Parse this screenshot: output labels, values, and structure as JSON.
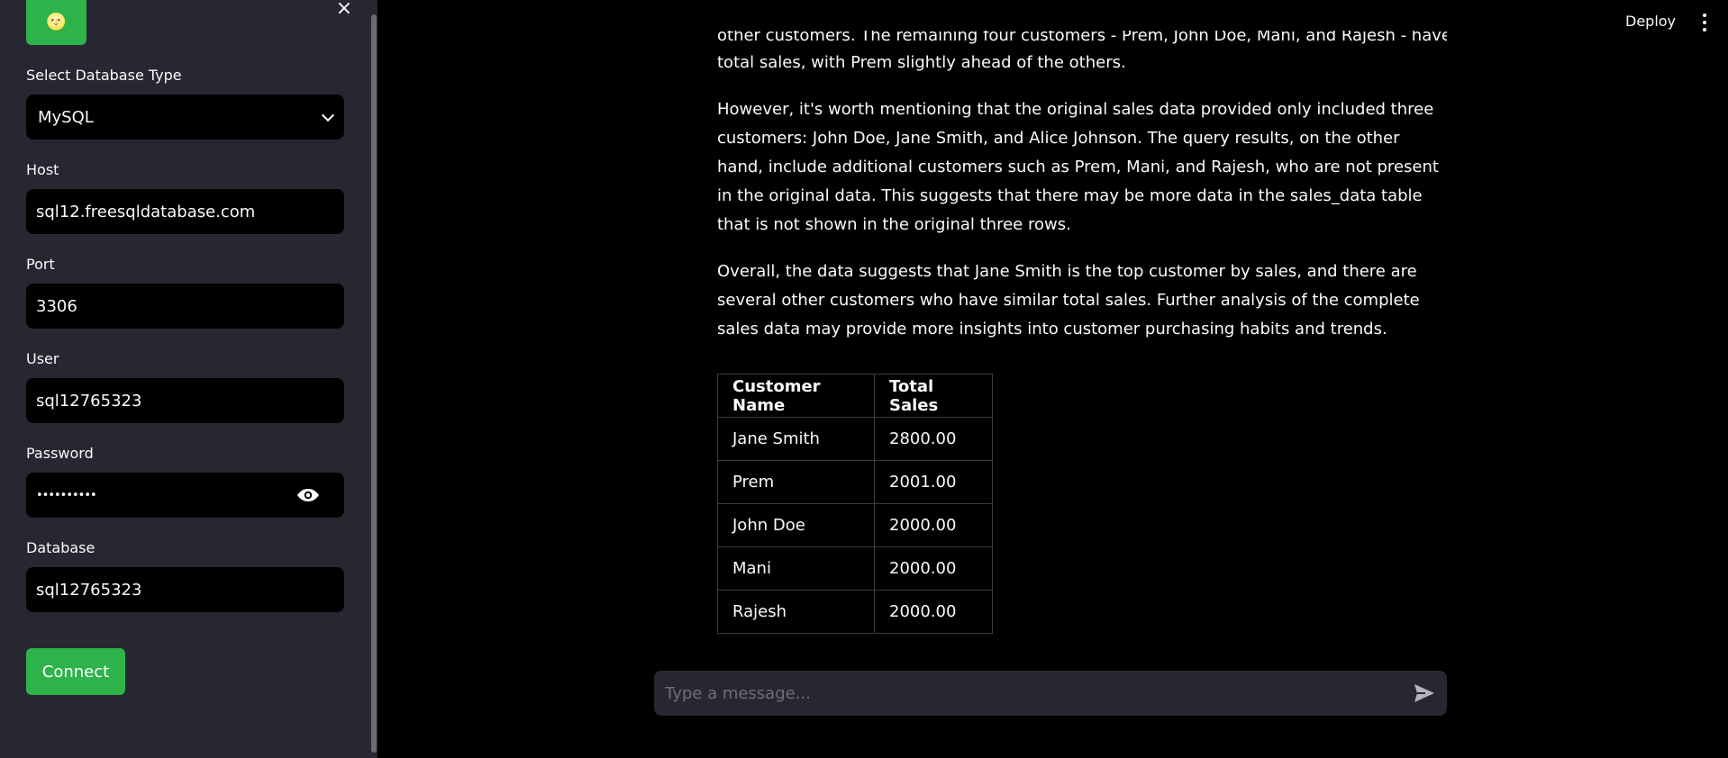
{
  "sidebar": {
    "close_glyph": "×",
    "logo_glyph": "🌝",
    "fields": {
      "db_type": {
        "label": "Select Database Type",
        "value": "MySQL"
      },
      "host": {
        "label": "Host",
        "value": "sql12.freesqldatabase.com"
      },
      "port": {
        "label": "Port",
        "value": "3306"
      },
      "user": {
        "label": "User",
        "value": "sql12765323"
      },
      "password": {
        "label": "Password",
        "value": "••••••••••"
      },
      "database": {
        "label": "Database",
        "value": "sql12765323"
      }
    },
    "connect_label": "Connect"
  },
  "header": {
    "deploy_label": "Deploy"
  },
  "chat": {
    "cut_line": "other customers. The remaining four customers - Prem, John Doe, Mani, and Rajesh - have similar",
    "p1_tail": "total sales, with Prem slightly ahead of the others.",
    "p2": "However, it's worth mentioning that the original sales data provided only included three customers: John Doe, Jane Smith, and Alice Johnson. The query results, on the other hand, include additional customers such as Prem, Mani, and Rajesh, who are not present in the original data. This suggests that there may be more data in the sales_data table that is not shown in the original three rows.",
    "p3": "Overall, the data suggests that Jane Smith is the top customer by sales, and there are several other customers who have similar total sales. Further analysis of the complete sales data may provide more insights into customer purchasing habits and trends.",
    "table": {
      "headers": [
        "Customer Name",
        "Total Sales"
      ],
      "rows": [
        [
          "Jane Smith",
          "2800.00"
        ],
        [
          "Prem",
          "2001.00"
        ],
        [
          "John Doe",
          "2000.00"
        ],
        [
          "Mani",
          "2000.00"
        ],
        [
          "Rajesh",
          "2000.00"
        ]
      ]
    },
    "input_placeholder": "Type a message..."
  },
  "colors": {
    "accent_green": "#2db34a",
    "sidebar_bg": "#262730",
    "main_bg": "#000000"
  },
  "icons": [
    "close-icon",
    "logo-icon",
    "chevron-down-icon",
    "eye-icon",
    "kebab-menu-icon",
    "send-icon"
  ]
}
